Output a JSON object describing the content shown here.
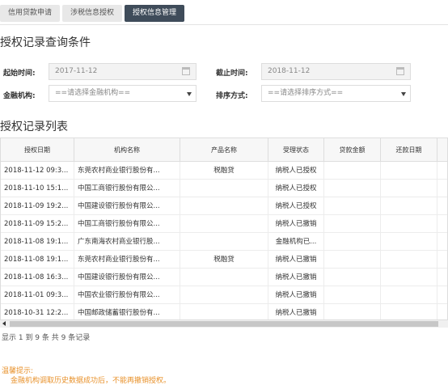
{
  "tabs": [
    {
      "label": "信用贷款申请",
      "active": false
    },
    {
      "label": "涉税信息授权",
      "active": false
    },
    {
      "label": "授权信息管理",
      "active": true
    }
  ],
  "query": {
    "title": "授权记录查询条件",
    "start_label": "起始时间:",
    "start_value": "2017-11-12",
    "end_label": "截止时间:",
    "end_value": "2018-11-12",
    "bank_label": "金融机构:",
    "bank_value": "==请选择金融机构==",
    "sort_label": "排序方式:",
    "sort_value": "==请选择排序方式=="
  },
  "list": {
    "title": "授权记录列表",
    "columns": [
      "授权日期",
      "机构名称",
      "产品名称",
      "受理状态",
      "贷款金额",
      "还款日期"
    ],
    "rows": [
      {
        "date": "2018-11-12 09:3...",
        "org": "东莞农村商业银行股份有...",
        "product": "税融贷",
        "status": "纳税人已授权",
        "amount": "",
        "repay": ""
      },
      {
        "date": "2018-11-10 15:1...",
        "org": "中国工商银行股份有限公...",
        "product": "",
        "status": "纳税人已授权",
        "amount": "",
        "repay": ""
      },
      {
        "date": "2018-11-09 19:2...",
        "org": "中国建设银行股份有限公...",
        "product": "",
        "status": "纳税人已授权",
        "amount": "",
        "repay": ""
      },
      {
        "date": "2018-11-09 15:2...",
        "org": "中国工商银行股份有限公...",
        "product": "",
        "status": "纳税人已撤销",
        "amount": "",
        "repay": ""
      },
      {
        "date": "2018-11-08 19:1...",
        "org": "广东南海农村商业银行股...",
        "product": "",
        "status": "金融机构已...",
        "amount": "",
        "repay": ""
      },
      {
        "date": "2018-11-08 19:1...",
        "org": "东莞农村商业银行股份有...",
        "product": "税融贷",
        "status": "纳税人已撤销",
        "amount": "",
        "repay": ""
      },
      {
        "date": "2018-11-08 16:3...",
        "org": "中国建设银行股份有限公...",
        "product": "",
        "status": "纳税人已撤销",
        "amount": "",
        "repay": ""
      },
      {
        "date": "2018-11-01 09:3...",
        "org": "中国农业银行股份有限公...",
        "product": "",
        "status": "纳税人已撤销",
        "amount": "",
        "repay": ""
      },
      {
        "date": "2018-10-31 12:2...",
        "org": "中国邮政储蓄银行股份有...",
        "product": "",
        "status": "纳税人已撤销",
        "amount": "",
        "repay": ""
      }
    ],
    "footer": "显示 1 到 9 条 共 9 条记录"
  },
  "tip": {
    "title": "温馨提示:",
    "text": "金融机构调取历史数据成功后，不能再撤销授权。"
  },
  "colors": {
    "active_tab": "#3f4c5a",
    "tip": "#e8922c"
  },
  "icons": {
    "calendar": "calendar-icon",
    "dropdown": "chevron-down-icon",
    "scroll_left": "arrow-left-icon"
  }
}
